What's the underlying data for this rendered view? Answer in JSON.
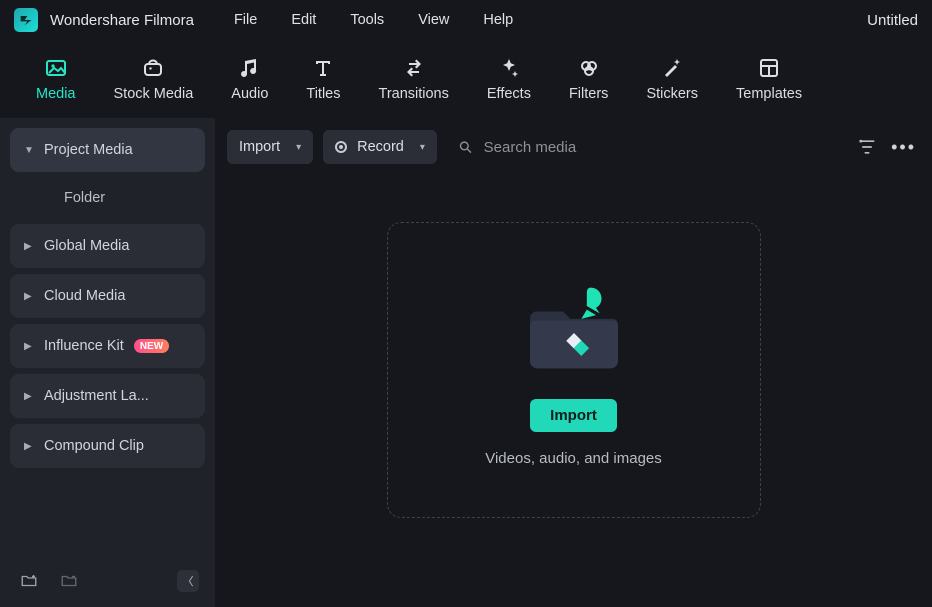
{
  "app": {
    "title": "Wondershare Filmora",
    "doc_title": "Untitled"
  },
  "menu": {
    "items": [
      "File",
      "Edit",
      "Tools",
      "View",
      "Help"
    ]
  },
  "toolbar": {
    "tabs": [
      {
        "label": "Media",
        "active": true
      },
      {
        "label": "Stock Media"
      },
      {
        "label": "Audio"
      },
      {
        "label": "Titles"
      },
      {
        "label": "Transitions"
      },
      {
        "label": "Effects"
      },
      {
        "label": "Filters"
      },
      {
        "label": "Stickers"
      },
      {
        "label": "Templates"
      }
    ]
  },
  "sidebar": {
    "items": [
      {
        "label": "Project Media",
        "expanded": true,
        "current": true
      },
      {
        "label": "Folder",
        "sub": true
      },
      {
        "label": "Global Media"
      },
      {
        "label": "Cloud Media"
      },
      {
        "label": "Influence Kit",
        "badge": "NEW"
      },
      {
        "label": "Adjustment La..."
      },
      {
        "label": "Compound Clip"
      }
    ]
  },
  "main": {
    "import_label": "Import",
    "record_label": "Record",
    "search_placeholder": "Search media",
    "dropzone": {
      "button": "Import",
      "caption": "Videos, audio, and images"
    }
  }
}
